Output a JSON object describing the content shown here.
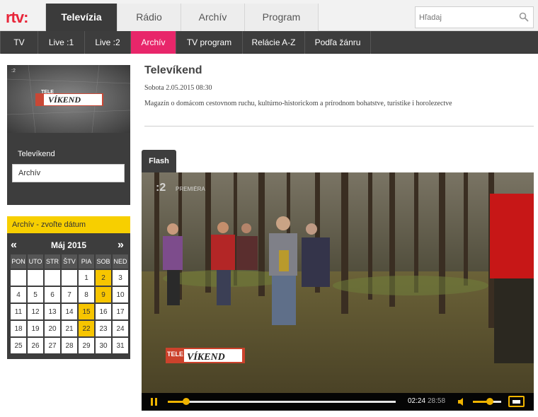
{
  "brand": {
    "logo": "rtv:"
  },
  "top_tabs": [
    "Televízia",
    "Rádio",
    "Archív",
    "Program"
  ],
  "search": {
    "placeholder": "Hľadaj"
  },
  "sub_nav": [
    "TV",
    "Live :1",
    "Live :2",
    "Archív",
    "TV program",
    "Relácie A-Z",
    "Podľa žánru"
  ],
  "sidebar": {
    "thumb_logo_top": "TELE",
    "thumb_logo_main": "VÍKEND",
    "show_title": "Televíkend",
    "selected_item": "Archív"
  },
  "calendar": {
    "header": "Archív - zvoľte dátum",
    "prev": "«",
    "next": "»",
    "month": "Máj 2015",
    "weekdays": [
      "PON",
      "UTO",
      "STR",
      "ŠTV",
      "PIA",
      "SOB",
      "NED"
    ],
    "weeks": [
      [
        "",
        "",
        "",
        "",
        "1",
        "2",
        "3"
      ],
      [
        "4",
        "5",
        "6",
        "7",
        "8",
        "9",
        "10"
      ],
      [
        "11",
        "12",
        "13",
        "14",
        "15",
        "16",
        "17"
      ],
      [
        "18",
        "19",
        "20",
        "21",
        "22",
        "23",
        "24"
      ],
      [
        "25",
        "26",
        "27",
        "28",
        "29",
        "30",
        "31"
      ]
    ],
    "highlighted_days": [
      "2",
      "9",
      "15",
      "22"
    ],
    "highlight_color": "#f7c500"
  },
  "main": {
    "title": "Televíkend",
    "date": "Sobota 2.05.2015 08:30",
    "description": "Magazín o domácom cestovnom ruchu, kultúrno-historickom a prírodnom bohatstve, turistike i horolezectve"
  },
  "player": {
    "tab_label": "Flash",
    "channel_logo": ":2",
    "channel_name": "PREMIÉRA",
    "overlay_top": "TELE",
    "overlay_main": "VÍKEND",
    "current_time": "02:24",
    "total_time": "28:58",
    "progress": 0.08,
    "volume": 0.6
  },
  "colors": {
    "brand_red": "#e8263a",
    "archive_pink": "#e8266a",
    "calendar_yellow": "#f7cf00",
    "dark_bg": "#3d3d3d"
  }
}
